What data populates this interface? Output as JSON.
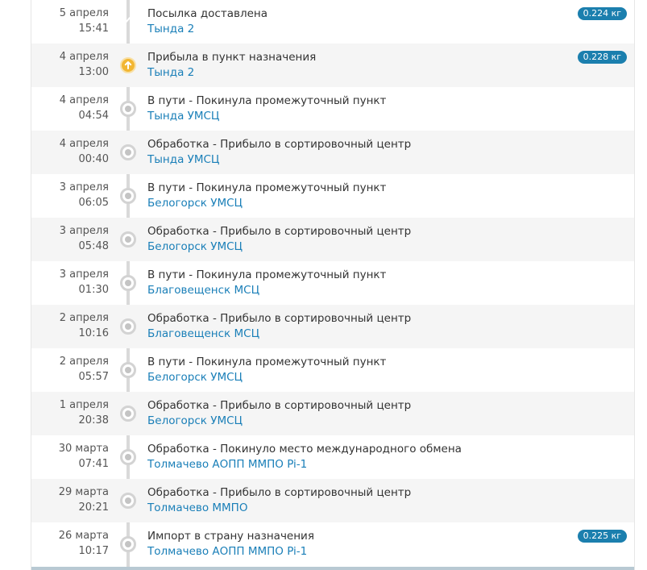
{
  "events": [
    {
      "date": "5 апреля",
      "time": "15:41",
      "title": "Посылка доставлена",
      "place": "Тында 2",
      "weight": "0.224 кг",
      "status": "delivered",
      "icon": "check-icon"
    },
    {
      "date": "4 апреля",
      "time": "13:00",
      "title": "Прибыла в пункт назначения",
      "place": "Тында 2",
      "weight": "0.228 кг",
      "status": "arrived",
      "icon": "arrow-up-icon"
    },
    {
      "date": "4 апреля",
      "time": "04:54",
      "title": "В пути - Покинула промежуточный пункт",
      "place": "Тында УМСЦ",
      "weight": "",
      "status": "pending",
      "icon": "dot-icon"
    },
    {
      "date": "4 апреля",
      "time": "00:40",
      "title": "Обработка - Прибыло в сортировочный центр",
      "place": "Тында УМСЦ",
      "weight": "",
      "status": "pending",
      "icon": "dot-icon"
    },
    {
      "date": "3 апреля",
      "time": "06:05",
      "title": "В пути - Покинула промежуточный пункт",
      "place": "Белогорск УМСЦ",
      "weight": "",
      "status": "pending",
      "icon": "dot-icon"
    },
    {
      "date": "3 апреля",
      "time": "05:48",
      "title": "Обработка - Прибыло в сортировочный центр",
      "place": "Белогорск УМСЦ",
      "weight": "",
      "status": "pending",
      "icon": "dot-icon"
    },
    {
      "date": "3 апреля",
      "time": "01:30",
      "title": "В пути - Покинула промежуточный пункт",
      "place": "Благовещенск МСЦ",
      "weight": "",
      "status": "pending",
      "icon": "dot-icon"
    },
    {
      "date": "2 апреля",
      "time": "10:16",
      "title": "Обработка - Прибыло в сортировочный центр",
      "place": "Благовещенск МСЦ",
      "weight": "",
      "status": "pending",
      "icon": "dot-icon"
    },
    {
      "date": "2 апреля",
      "time": "05:57",
      "title": "В пути - Покинула промежуточный пункт",
      "place": "Белогорск УМСЦ",
      "weight": "",
      "status": "pending",
      "icon": "dot-icon"
    },
    {
      "date": "1 апреля",
      "time": "20:38",
      "title": "Обработка - Прибыло в сортировочный центр",
      "place": "Белогорск УМСЦ",
      "weight": "",
      "status": "pending",
      "icon": "dot-icon"
    },
    {
      "date": "30 марта",
      "time": "07:41",
      "title": "Обработка - Покинуло место международного обмена",
      "place": "Толмачево АОПП ММПО Pi-1",
      "weight": "",
      "status": "pending",
      "icon": "dot-icon"
    },
    {
      "date": "29 марта",
      "time": "20:21",
      "title": "Обработка - Прибыло в сортировочный центр",
      "place": "Толмачево ММПО",
      "weight": "",
      "status": "pending",
      "icon": "dot-icon"
    },
    {
      "date": "26 марта",
      "time": "10:17",
      "title": "Импорт в страну назначения",
      "place": "Толмачево АОПП ММПО Pi-1",
      "weight": "0.225 кг",
      "status": "pending",
      "icon": "dot-icon"
    }
  ],
  "colors": {
    "link": "#1a7fb8",
    "badge": "#1b7fae",
    "delivered": "#2fb55d",
    "arrived": "#f2b632",
    "alt_row": "#f5f5f5"
  }
}
